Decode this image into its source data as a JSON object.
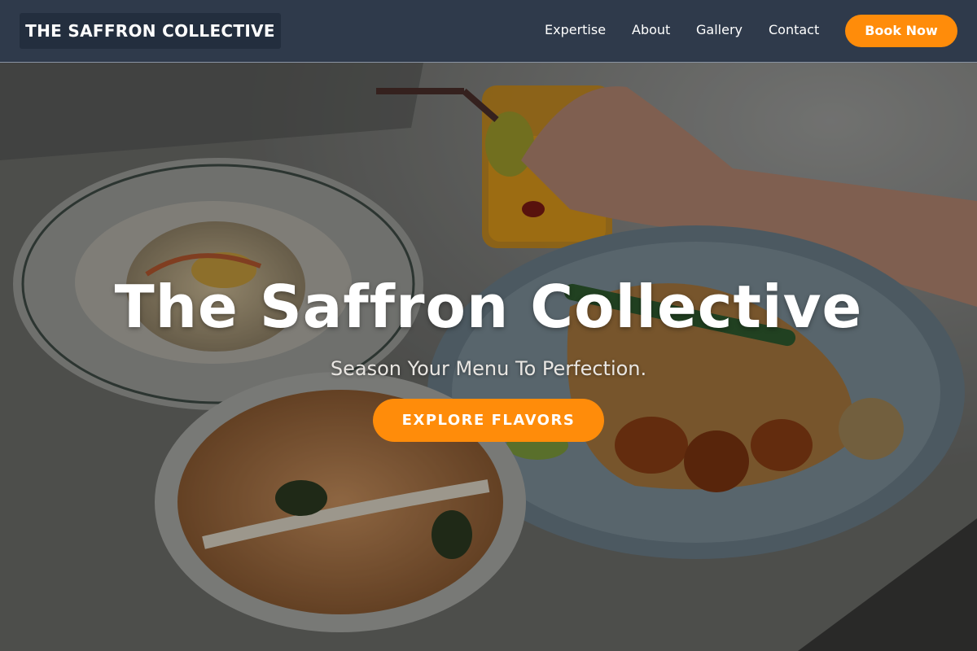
{
  "brand": {
    "name": "THE SAFFRON COLLECTIVE"
  },
  "nav": {
    "links": [
      {
        "label": "Expertise"
      },
      {
        "label": "About"
      },
      {
        "label": "Gallery"
      },
      {
        "label": "Contact"
      }
    ],
    "cta_label": "Book Now"
  },
  "hero": {
    "title": "The Saffron Collective",
    "subtitle": "Season Your Menu To Perfection.",
    "cta_label": "EXPLORE FLAVORS",
    "image": "food-spread-photo"
  },
  "colors": {
    "navbar": "#2f3a4b",
    "brand_bg": "#232e3e",
    "accent": "#ff8c0a",
    "text": "#ffffff"
  }
}
